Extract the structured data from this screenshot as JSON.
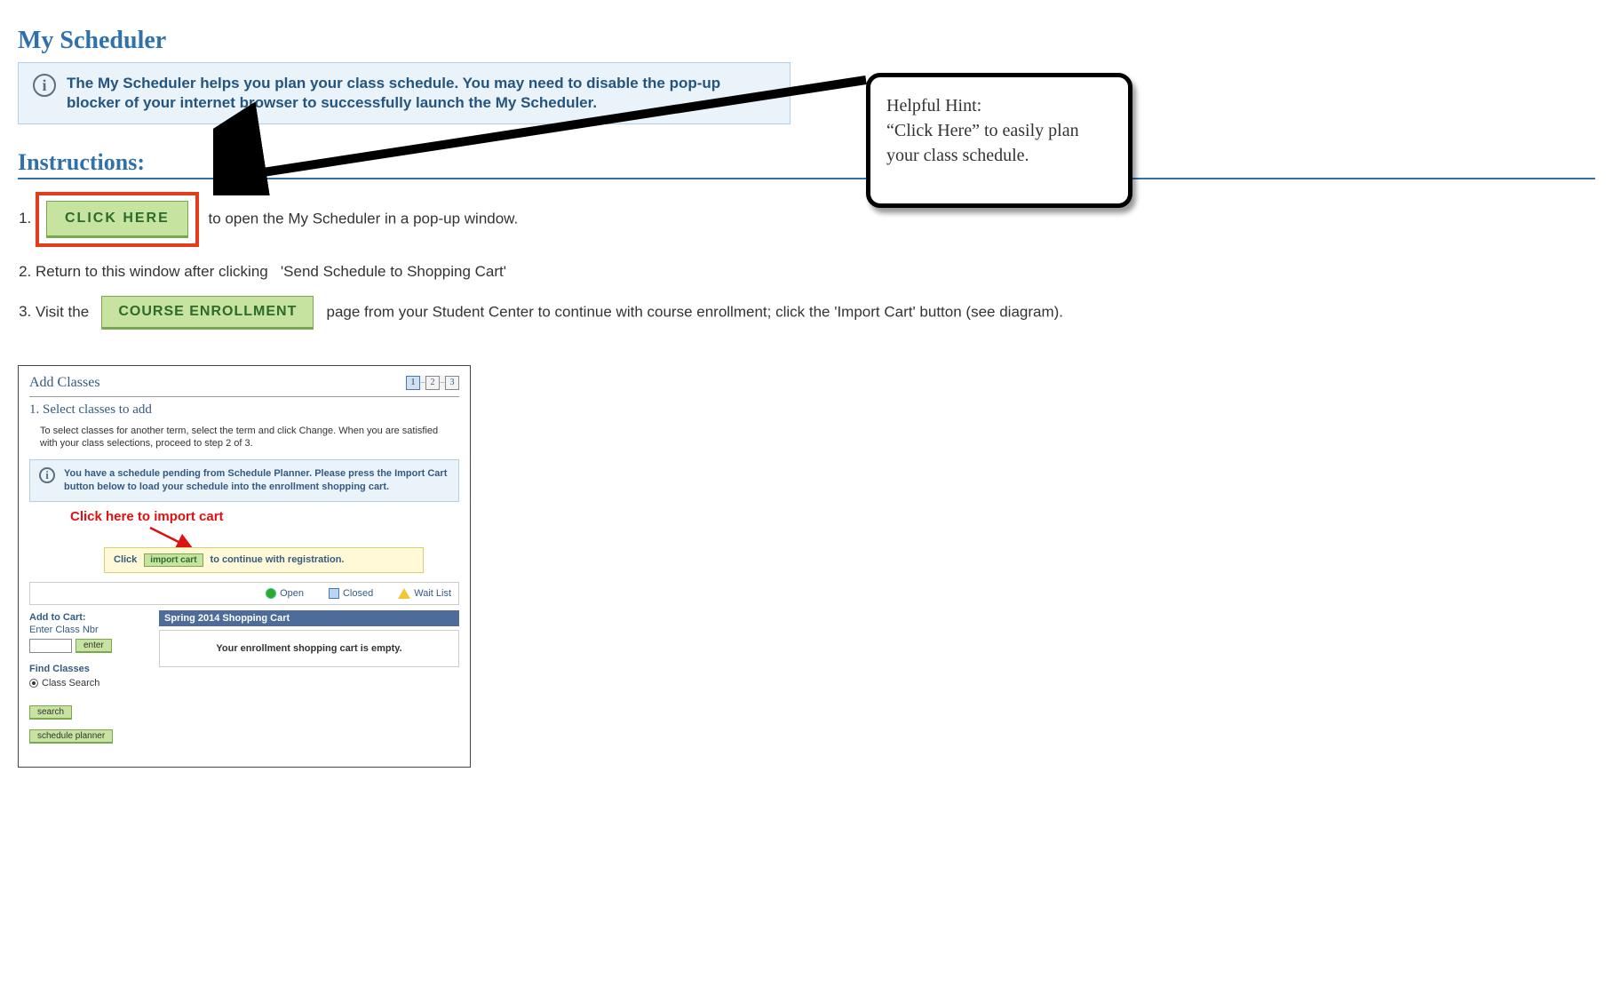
{
  "page_title": "My Scheduler",
  "info_banner": "The My Scheduler helps you plan your class schedule.  You may need to disable the pop-up blocker of your internet browser to successfully launch the My Scheduler.",
  "instructions_heading": "Instructions:",
  "step1": {
    "button": "CLICK HERE",
    "after": "to open the My Scheduler in a pop-up window."
  },
  "step2": {
    "text": "Return to this window after clicking",
    "quoted": "'Send Schedule to Shopping Cart'"
  },
  "step3": {
    "before": "Visit the",
    "button": "COURSE ENROLLMENT",
    "after": "page from your Student Center to continue with course enrollment; click the 'Import Cart' button (see diagram)."
  },
  "hint": {
    "title": "Helpful Hint:",
    "line1": "“Click Here” to easily plan",
    "line2": "your class schedule."
  },
  "diagram": {
    "title": "Add Classes",
    "steps": [
      "1",
      "2",
      "3"
    ],
    "subheading": "1.  Select classes to add",
    "instr": "To select classes for another term, select the term and click Change.  When you are satisfied with your class selections, proceed to step 2 of 3.",
    "info": "You have a schedule pending from Schedule Planner.  Please press the Import Cart button below to load your schedule into the enrollment shopping cart.",
    "red_callout": "Click here to import cart",
    "yellow": {
      "before": "Click",
      "button": "import cart",
      "after": "to continue with registration."
    },
    "legend": {
      "open": "Open",
      "closed": "Closed",
      "wait": "Wait List"
    },
    "left": {
      "add_to_cart": "Add to Cart:",
      "enter_class_nbr": "Enter Class Nbr",
      "enter_btn": "enter",
      "find_classes": "Find Classes",
      "radio_label": "Class Search",
      "search_btn": "search",
      "planner_btn": "schedule planner"
    },
    "right": {
      "cart_header": "Spring 2014 Shopping Cart",
      "cart_empty": "Your enrollment shopping cart is empty."
    }
  }
}
